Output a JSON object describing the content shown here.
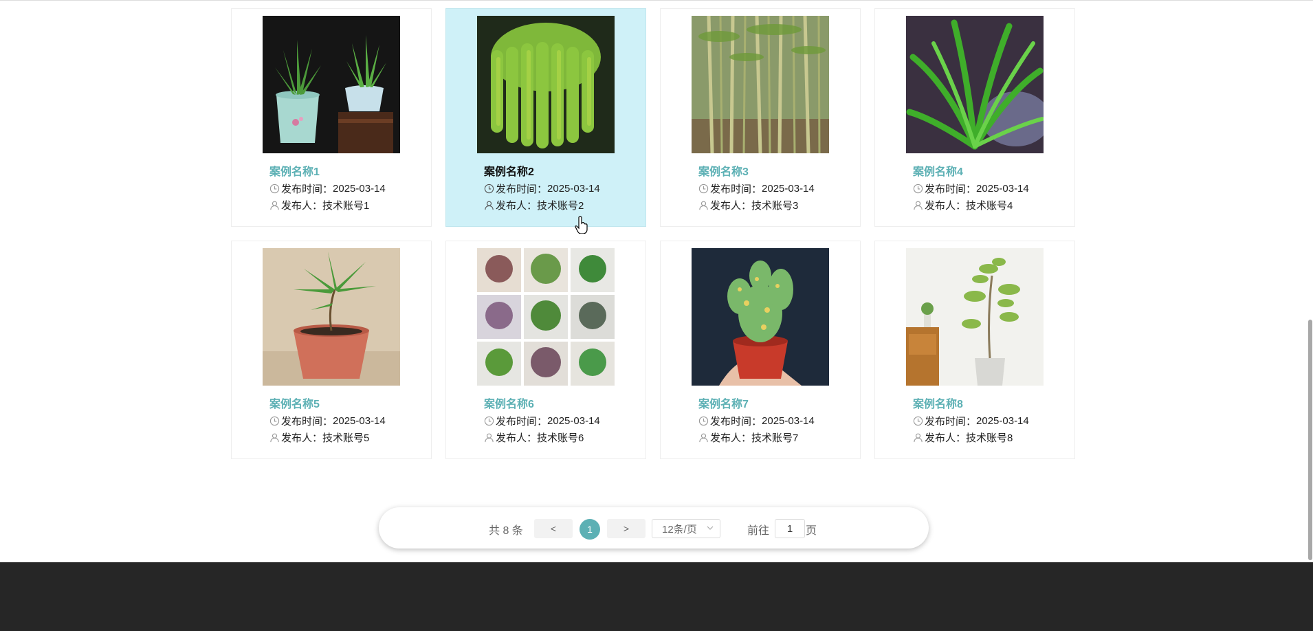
{
  "cases": [
    {
      "title": "案例名称1",
      "time_label": "发布时间：",
      "time": "2025-03-14",
      "author_label": "发布人：",
      "author": "技术账号1",
      "image": "aloe-pots-photo"
    },
    {
      "title": "案例名称2",
      "time_label": "发布时间：",
      "time": "2025-03-14",
      "author_label": "发布人：",
      "author": "技术账号2",
      "image": "hanging-succulent-photo"
    },
    {
      "title": "案例名称3",
      "time_label": "发布时间：",
      "time": "2025-03-14",
      "author_label": "发布人：",
      "author": "技术账号3",
      "image": "bamboo-photo"
    },
    {
      "title": "案例名称4",
      "time_label": "发布时间：",
      "time": "2025-03-14",
      "author_label": "发布人：",
      "author": "技术账号4",
      "image": "grass-leaves-photo"
    },
    {
      "title": "案例名称5",
      "time_label": "发布时间：",
      "time": "2025-03-14",
      "author_label": "发布人：",
      "author": "技术账号5",
      "image": "potted-seedling-photo"
    },
    {
      "title": "案例名称6",
      "time_label": "发布时间：",
      "time": "2025-03-14",
      "author_label": "发布人：",
      "author": "技术账号6",
      "image": "plant-collage-photo"
    },
    {
      "title": "案例名称7",
      "time_label": "发布时间：",
      "time": "2025-03-14",
      "author_label": "发布人：",
      "author": "技术账号7",
      "image": "cactus-in-hand-photo"
    },
    {
      "title": "案例名称8",
      "time_label": "发布时间：",
      "time": "2025-03-14",
      "author_label": "发布人：",
      "author": "技术账号8",
      "image": "indoor-tree-photo"
    }
  ],
  "pagination": {
    "total": "共 8 条",
    "prev": "<",
    "current_page": "1",
    "next": ">",
    "page_size": "12条/页",
    "goto_prefix": "前往",
    "goto_value": "1",
    "goto_suffix": "页"
  },
  "colors": {
    "accent": "#5cb0b4",
    "hover_card": "#cff1f8",
    "footer": "#262626"
  },
  "icons": {
    "time": "clock-icon",
    "author": "user-icon",
    "dropdown": "chevron-down-icon"
  }
}
